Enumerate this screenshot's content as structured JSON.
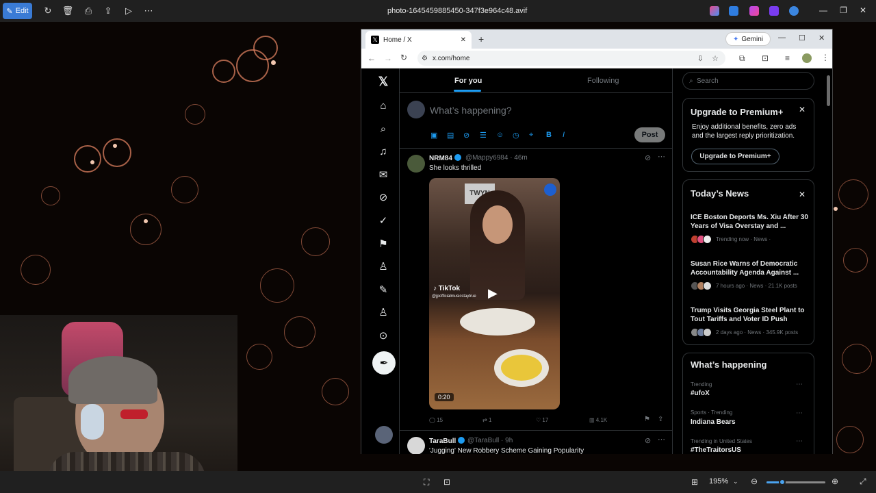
{
  "app_toolbar": {
    "edit_label": "Edit",
    "file_name": "photo-1645459885450-347f3e964c48.avif"
  },
  "bottom_bar": {
    "zoom_value": "195%",
    "zoom_fraction": 0.27
  },
  "browser": {
    "tab_title": "Home / X",
    "address": "x.com/home",
    "gemini_label": "Gemini"
  },
  "x": {
    "tabs": [
      {
        "label": "For you",
        "active": true
      },
      {
        "label": "Following",
        "active": false
      }
    ],
    "compose_placeholder": "What’s happening?",
    "post_label": "Post",
    "tweets": [
      {
        "name": "NRM84",
        "handle": "@Mappy6984 · 46m",
        "text": "She looks thrilled",
        "media": {
          "brand": "TikTok",
          "tiktok_user": "@jpofficialmusicstaytrue",
          "duration": "0:20",
          "sign": "TWYN"
        },
        "actions": {
          "replies": "15",
          "reposts": "1",
          "likes": "17",
          "views": "4.1K"
        }
      },
      {
        "name": "TaraBull",
        "handle": "@TaraBull · 9h",
        "text": "'Jugging' New Robbery Scheme Gaining Popularity"
      }
    ],
    "search_placeholder": "Search",
    "premium": {
      "title": "Upgrade to Premium+",
      "body": "Enjoy additional benefits, zero ads and the largest reply prioritization.",
      "button": "Upgrade to Premium+"
    },
    "news": {
      "title": "Today’s News",
      "items": [
        {
          "headline": "ICE Boston Deports Ms. Xiu After 30 Years of Visa Overstay and ...",
          "meta": "Trending now · News ·"
        },
        {
          "headline": "Susan Rice Warns of Democratic Accountability Agenda Against ...",
          "meta": "7 hours ago · News · 21.1K posts"
        },
        {
          "headline": "Trump Visits Georgia Steel Plant to Tout Tariffs and Voter ID Push",
          "meta": "2 days ago · News · 345.9K posts"
        }
      ]
    },
    "happening": {
      "title": "What’s happening",
      "items": [
        {
          "meta": "Trending",
          "topic": "#ufoX"
        },
        {
          "meta": "Sports · Trending",
          "topic": "Indiana Bears"
        },
        {
          "meta": "Trending in United States",
          "topic": "#TheTraitorsUS"
        }
      ]
    }
  },
  "colors": {
    "accent": "#1d9bf0",
    "photos_accent": "#3a7bd5",
    "background_rings": "#de8060"
  }
}
